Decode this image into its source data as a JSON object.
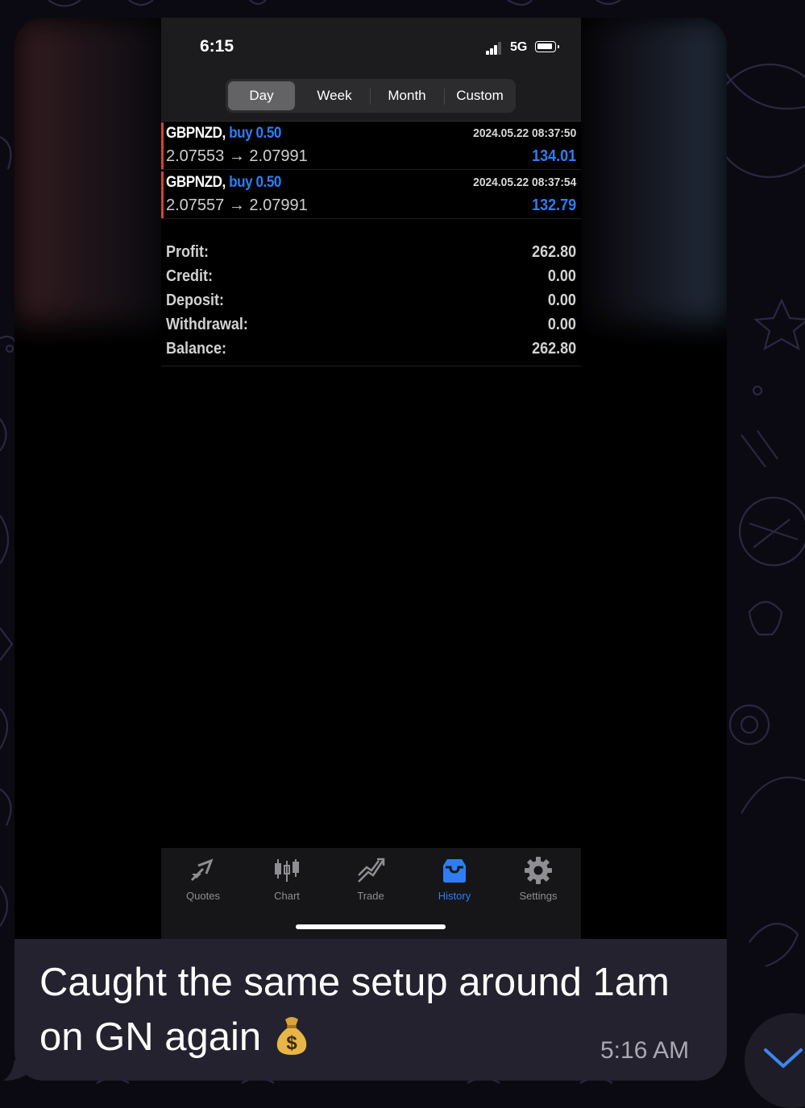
{
  "phone": {
    "status": {
      "time": "6:15",
      "network": "5G"
    },
    "period_tabs": [
      {
        "label": "Day",
        "active": true
      },
      {
        "label": "Week",
        "active": false
      },
      {
        "label": "Month",
        "active": false
      },
      {
        "label": "Custom",
        "active": false
      }
    ],
    "trades": [
      {
        "symbol": "GBPNZD,",
        "direction": "buy 0.50",
        "datetime": "2024.05.22 08:37:50",
        "prices": "2.07553 → 2.07991",
        "profit": "134.01"
      },
      {
        "symbol": "GBPNZD,",
        "direction": "buy 0.50",
        "datetime": "2024.05.22 08:37:54",
        "prices": "2.07557 → 2.07991",
        "profit": "132.79"
      }
    ],
    "summary": [
      {
        "label": "Profit:",
        "value": "262.80"
      },
      {
        "label": "Credit:",
        "value": "0.00"
      },
      {
        "label": "Deposit:",
        "value": "0.00"
      },
      {
        "label": "Withdrawal:",
        "value": "0.00"
      },
      {
        "label": "Balance:",
        "value": "262.80"
      }
    ],
    "tabbar": [
      {
        "label": "Quotes",
        "icon": "quotes-icon",
        "active": false
      },
      {
        "label": "Chart",
        "icon": "chart-icon",
        "active": false
      },
      {
        "label": "Trade",
        "icon": "trade-icon",
        "active": false
      },
      {
        "label": "History",
        "icon": "history-icon",
        "active": true
      },
      {
        "label": "Settings",
        "icon": "settings-icon",
        "active": false
      }
    ]
  },
  "message": {
    "line1": "Caught the same setup around 1am",
    "line2": "on GN again",
    "emoji": "money-bag-icon",
    "time": "5:16 AM"
  },
  "colors": {
    "accent_blue": "#2f7df6",
    "trade_marker_red": "#d0443a",
    "bubble": "#23222e"
  }
}
